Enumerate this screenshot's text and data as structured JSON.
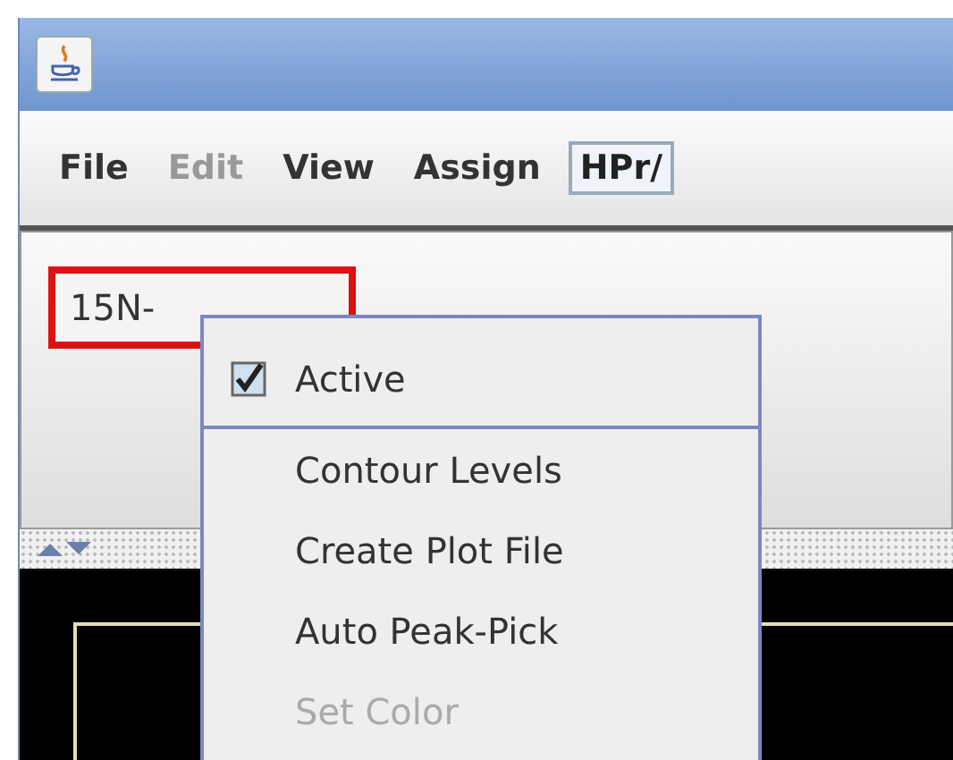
{
  "menubar": {
    "menus": [
      {
        "label": "File",
        "disabled": false
      },
      {
        "label": "Edit",
        "disabled": true
      },
      {
        "label": "View",
        "disabled": false
      },
      {
        "label": "Assign",
        "disabled": false
      }
    ],
    "combo": {
      "value": "HPr/"
    }
  },
  "spectrum_label": {
    "text": "15N-",
    "selected": true
  },
  "context_menu": {
    "items": [
      {
        "kind": "check",
        "label": "Active",
        "checked": true,
        "disabled": false,
        "separator_after": true
      },
      {
        "kind": "action",
        "label": "Contour Levels",
        "disabled": false,
        "separator_after": false
      },
      {
        "kind": "action",
        "label": "Create Plot File",
        "disabled": false,
        "separator_after": false
      },
      {
        "kind": "action",
        "label": "Auto Peak-Pick",
        "disabled": false,
        "separator_after": false
      },
      {
        "kind": "action",
        "label": "Set Color",
        "disabled": true,
        "separator_after": false
      }
    ]
  }
}
